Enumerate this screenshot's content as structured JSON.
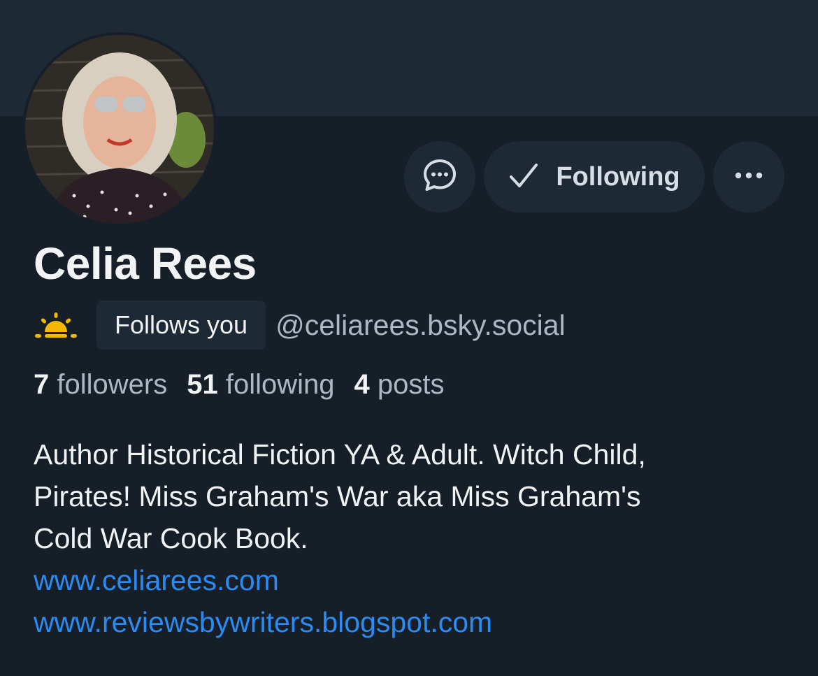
{
  "profile": {
    "display_name": "Celia Rees",
    "handle": "@celiarees.bsky.social",
    "follows_you_label": "Follows you",
    "status_icon": "sun-icon"
  },
  "actions": {
    "message_icon": "message-icon",
    "following_label": "Following",
    "more_icon": "more-icon"
  },
  "stats": {
    "followers_count": "7",
    "followers_label": "followers",
    "following_count": "51",
    "following_label": "following",
    "posts_count": "4",
    "posts_label": "posts"
  },
  "bio": {
    "lines": [
      "Author Historical Fiction YA & Adult. Witch Child,",
      "Pirates! Miss Graham's War aka Miss Graham's",
      "Cold War Cook Book."
    ],
    "links": [
      "www.celiarees.com",
      "www.reviewsbywriters.blogspot.com"
    ]
  },
  "colors": {
    "background": "#161e27",
    "banner": "#1e2936",
    "link": "#2a8bf2",
    "sun": "#f5b800"
  }
}
